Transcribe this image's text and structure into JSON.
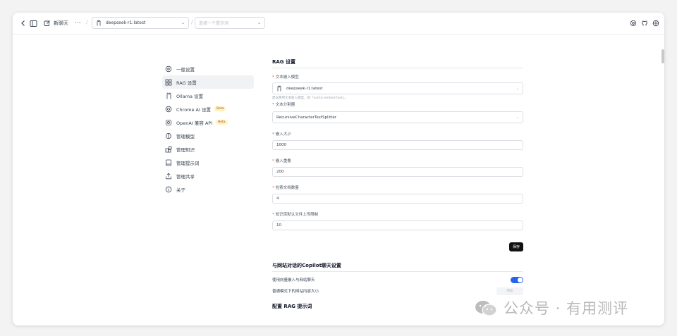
{
  "topbar": {
    "new_chat": "新聊天",
    "model_value": "deepseek-r1:latest",
    "prompt_placeholder": "选择一个提示词"
  },
  "sidebar": {
    "items": [
      {
        "label": "一般设置",
        "icon": "settings-circle-icon"
      },
      {
        "label": "RAG 设置",
        "icon": "grid-icon",
        "active": true
      },
      {
        "label": "Ollama 设置",
        "icon": "ollama-icon"
      },
      {
        "label": "Chrome AI 设置",
        "icon": "chrome-icon",
        "badge": "Beta"
      },
      {
        "label": "OpenAI 兼容 API",
        "icon": "openai-icon",
        "badge": "Beta"
      },
      {
        "label": "管理模型",
        "icon": "brain-icon"
      },
      {
        "label": "管理知识",
        "icon": "blocks-icon"
      },
      {
        "label": "管理提示词",
        "icon": "book-icon"
      },
      {
        "label": "管理共享",
        "icon": "share-icon"
      },
      {
        "label": "关于",
        "icon": "info-icon"
      }
    ]
  },
  "rag": {
    "title": "RAG 设置",
    "embedding_label": "文本嵌入模型",
    "embedding_value": "deepseek-r1:latest",
    "embedding_hint": "建议使用文本嵌入模型，如「nomic-embed-text」。",
    "splitter_label": "文本分割器",
    "splitter_value": "RecursiveCharacterTextSplitter",
    "chunk_size_label": "嵌入大小",
    "chunk_size_value": "1000",
    "chunk_overlap_label": "嵌入重叠",
    "chunk_overlap_value": "200",
    "retrieved_docs_label": "检索文档数量",
    "retrieved_docs_value": "4",
    "kb_upload_label": "知识库默认文件上传限制",
    "kb_upload_value": "10",
    "save_label": "保存"
  },
  "copilot": {
    "title": "与网站对话的Copilot聊天设置",
    "use_vector_label": "使用向量嵌入与网站聊天",
    "use_vector_on": true,
    "content_size_label": "普通模式下的网站内容大小",
    "content_size_placeholder": "例如"
  },
  "prompt_config": {
    "title": "配置 RAG 提示词"
  },
  "watermark": {
    "text": "公众号 · 有用测评"
  },
  "colors": {
    "accent": "#2563eb",
    "required": "#ef4444",
    "beta_bg": "#fef3c7"
  }
}
